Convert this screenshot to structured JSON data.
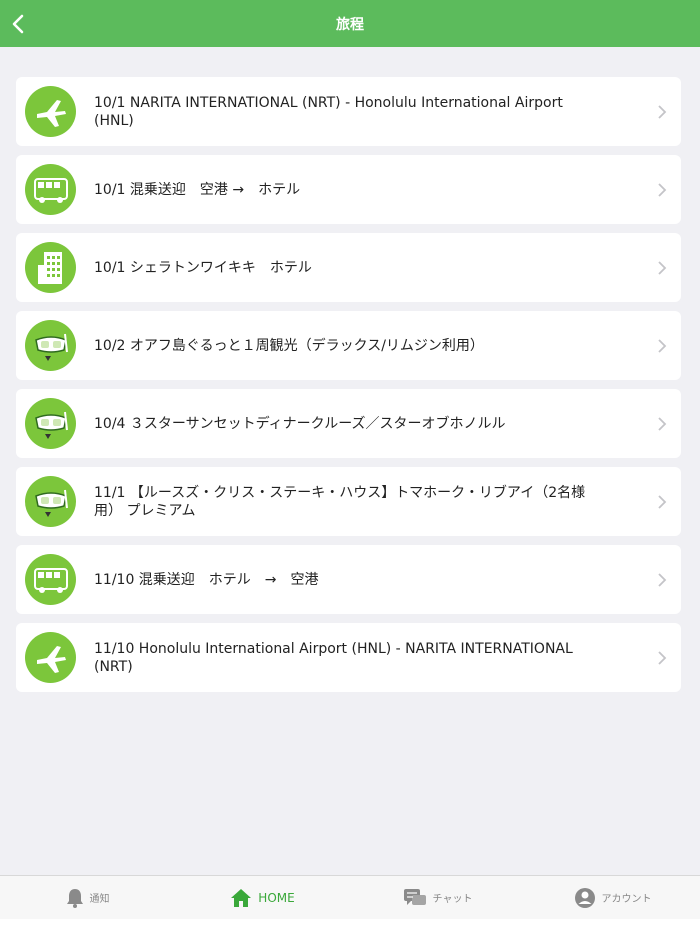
{
  "header": {
    "title": "旅程",
    "back_icon": "chevron-left-icon",
    "color": "#5cbb5c"
  },
  "itinerary": [
    {
      "label": "10/1 NARITA INTERNATIONAL (NRT) - Honolulu International Airport (HNL)",
      "icon": "airplane-icon"
    },
    {
      "label": "10/1 混乗送迎　空港 →　ホテル",
      "icon": "bus-icon"
    },
    {
      "label": "10/1 シェラトンワイキキ　ホテル",
      "icon": "hotel-icon"
    },
    {
      "label": "10/2 オアフ島ぐるっと１周観光（デラックス/リムジン利用）",
      "icon": "activity-icon"
    },
    {
      "label": "10/4 ３スターサンセットディナークルーズ／スターオブホノルル",
      "icon": "activity-icon"
    },
    {
      "label": "11/1 【ルースズ・クリス・ステーキ・ハウス】トマホーク・リブアイ（2名様用） プレミアム",
      "icon": "activity-icon"
    },
    {
      "label": "11/10 混乗送迎　ホテル　→　空港",
      "icon": "bus-icon"
    },
    {
      "label": "11/10 Honolulu International Airport (HNL) - NARITA INTERNATIONAL (NRT)",
      "icon": "airplane-icon"
    }
  ],
  "tabbar": {
    "tabs": [
      {
        "label": "通知",
        "icon": "bell-icon",
        "active": false
      },
      {
        "label": "HOME",
        "icon": "home-icon",
        "active": true
      },
      {
        "label": "チャット",
        "icon": "chat-icon",
        "active": false
      },
      {
        "label": "アカウント",
        "icon": "account-icon",
        "active": false
      }
    ],
    "active_color": "#3aa83a"
  }
}
